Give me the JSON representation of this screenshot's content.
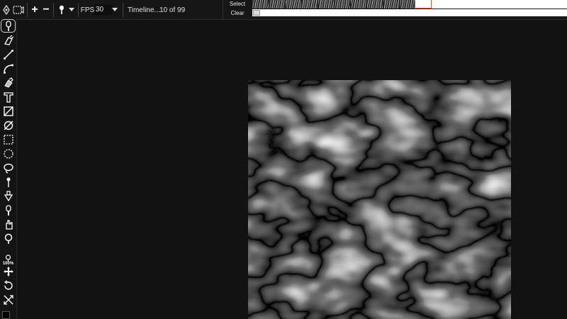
{
  "toolbar": {
    "add_frame_symbol": "+",
    "remove_frame_symbol": "−",
    "fps_label": "FPS",
    "fps_value": "30",
    "timeline_label": "Timeline...",
    "frame_counter": "10 of 99",
    "icons": [
      "onion-skin-icon",
      "frame-film-icon",
      "add-icon",
      "remove-icon",
      "brush-icon",
      "caret-down-icon"
    ]
  },
  "timeline": {
    "select_label": "Select",
    "clear_label": "Clear",
    "current_frame": 10,
    "total_frames": 99,
    "scroll_position": 0.0,
    "accent_color": "#e8542a"
  },
  "tools": [
    {
      "name": "brush-tool",
      "icon": "brush-icon",
      "active": true
    },
    {
      "name": "paint-roller-tool",
      "icon": "paint-roller-icon"
    },
    {
      "name": "line-tool",
      "icon": "line-icon"
    },
    {
      "name": "curve-tool",
      "icon": "curve-icon"
    },
    {
      "name": "stamp-tool",
      "icon": "stamp-icon"
    },
    {
      "name": "text-tool",
      "icon": "text-icon"
    },
    {
      "name": "square-slash-tool",
      "icon": "square-slash-icon"
    },
    {
      "name": "circle-slash-tool",
      "icon": "circle-slash-icon"
    },
    {
      "name": "rect-select-tool",
      "icon": "rect-select-icon"
    },
    {
      "name": "ellipse-select-tool",
      "icon": "ellipse-select-icon"
    },
    {
      "name": "lasso-tool",
      "icon": "lasso-icon"
    },
    {
      "name": "eyedropper-tool",
      "icon": "eyedropper-icon"
    },
    {
      "name": "fill-tool",
      "icon": "paint-bucket-icon"
    },
    {
      "name": "smudge-tool",
      "icon": "smudge-icon"
    },
    {
      "name": "hand-tool",
      "icon": "hand-icon"
    },
    {
      "name": "zoom-tool",
      "icon": "zoom-icon"
    },
    {
      "name": "zoom-100-tool",
      "icon": "zoom-100-icon"
    },
    {
      "name": "move-tool",
      "icon": "move-arrows-icon"
    },
    {
      "name": "rotate-tool",
      "icon": "rotate-icon"
    },
    {
      "name": "flip-tool",
      "icon": "flip-icon"
    }
  ],
  "zoom_label": "100%",
  "colors": {
    "foreground": "#000000",
    "background": "#121212",
    "panel": "#161616"
  }
}
